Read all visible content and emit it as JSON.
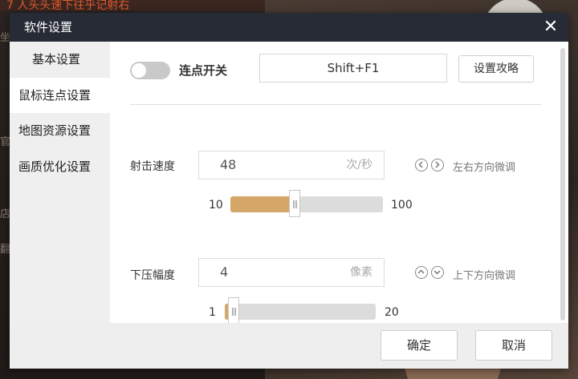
{
  "background": {
    "top_strip_text": "7 人头头速下往乎记射右",
    "side_chars": [
      "坐",
      "官",
      "店",
      "翻"
    ]
  },
  "dialog": {
    "title": "软件设置",
    "close_icon": "close-icon",
    "sidebar": {
      "items": [
        {
          "label": "基本设置",
          "active": false
        },
        {
          "label": "鼠标连点设置",
          "active": true
        },
        {
          "label": "地图资源设置",
          "active": false
        },
        {
          "label": "画质优化设置",
          "active": false
        }
      ]
    },
    "toggle": {
      "label": "连点开关",
      "on": false
    },
    "hotkey": {
      "value": "Shift+F1"
    },
    "guide_button": "设置攻略",
    "speed": {
      "label": "射击速度",
      "value": "48",
      "unit": "次/秒",
      "hint": "左右方向微调",
      "min": "10",
      "max": "100",
      "fraction": 0.42
    },
    "pressure": {
      "label": "下压幅度",
      "value": "4",
      "unit": "像素",
      "hint": "上下方向微调",
      "min": "1",
      "max": "20",
      "fraction": 0.06
    },
    "footer": {
      "ok": "确定",
      "cancel": "取消"
    },
    "colors": {
      "titlebar": "#262b35",
      "accent": "#d4a769",
      "sidebar": "#efefef"
    }
  }
}
